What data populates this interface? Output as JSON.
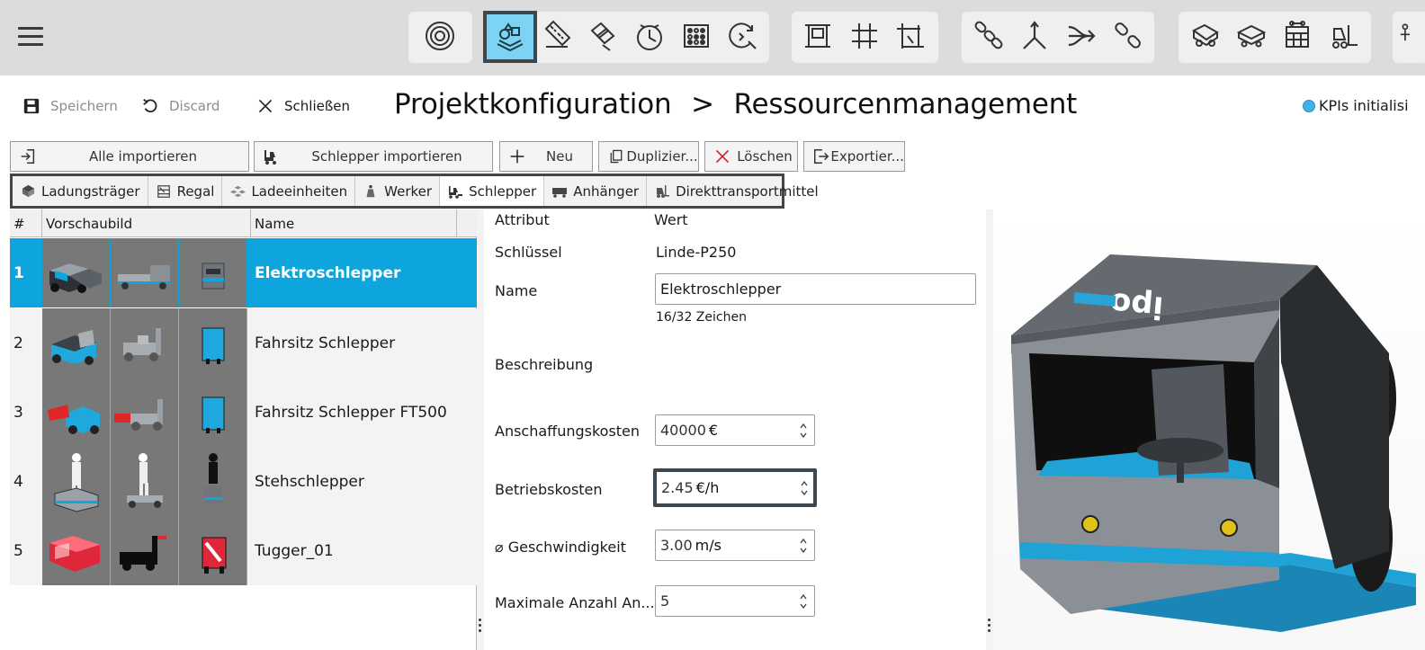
{
  "toolbar": {
    "buttons": [
      "radar-icon",
      "resource-shapes-icon",
      "ruler-icon",
      "layers-icon",
      "clock-icon",
      "matrix-icon",
      "zoom-refresh-icon",
      "frame-icon",
      "grid-icon",
      "align-icon",
      "chain-icon",
      "merge-icon",
      "split-arrows-icon",
      "link-icon",
      "tugger-icon",
      "cart-icon",
      "shelf-icon",
      "forklift-icon",
      "worker-icon"
    ],
    "active": "resource-shapes-icon"
  },
  "actions": {
    "save_label": "Speichern",
    "discard_label": "Discard",
    "close_label": "Schließen"
  },
  "breadcrumb": {
    "title": "Projektkonfiguration",
    "separator": ">",
    "current": "Ressourcenmanagement"
  },
  "kpi_status": "KPIs initialisi",
  "import_buttons": {
    "import_all": "Alle importieren",
    "import_tugger": "Schlepper importieren",
    "new": "Neu",
    "duplicate": "Duplizier...",
    "delete": "Löschen",
    "export": "Exportier..."
  },
  "category_tabs": [
    {
      "label": "Ladungsträger",
      "icon": "box-icon"
    },
    {
      "label": "Regal",
      "icon": "shelf-icon"
    },
    {
      "label": "Ladeeinheiten",
      "icon": "units-icon"
    },
    {
      "label": "Werker",
      "icon": "worker-icon"
    },
    {
      "label": "Schlepper",
      "icon": "tugger-icon",
      "active": true
    },
    {
      "label": "Anhänger",
      "icon": "trailer-icon"
    },
    {
      "label": "Direkttransportmittel",
      "icon": "forklift-icon"
    }
  ],
  "table": {
    "columns": {
      "num": "#",
      "preview": "Vorschaubild",
      "name": "Name"
    },
    "rows": [
      {
        "num": "1",
        "name": "Elektroschlepper",
        "selected": true
      },
      {
        "num": "2",
        "name": "Fahrsitz Schlepper"
      },
      {
        "num": "3",
        "name": "Fahrsitz Schlepper FT500"
      },
      {
        "num": "4",
        "name": "Stehschlepper"
      },
      {
        "num": "5",
        "name": "Tugger_01"
      }
    ]
  },
  "attributes": {
    "header_attr": "Attribut",
    "header_value": "Wert",
    "key_label": "Schlüssel",
    "key_value": "Linde-P250",
    "name_label": "Name",
    "name_value": "Elektroschlepper",
    "name_counter": "16/32 Zeichen",
    "description_label": "Beschreibung",
    "acquisition_label": "Anschaffungskosten",
    "acquisition_value": "40000",
    "acquisition_unit": "€",
    "operating_label": "Betriebskosten",
    "operating_value": "2.45",
    "operating_unit": "€/h",
    "speed_label": "⌀  Geschwindigkeit",
    "speed_value": "3.00",
    "speed_unit": "m/s",
    "max_label": "Maximale Anzahl An...",
    "max_value": "5"
  },
  "preview_logo": "ipo",
  "colors": {
    "accent": "#0ea5de",
    "highlight_border": "#3d474d",
    "toolbar_bg": "#dcdcdc"
  }
}
